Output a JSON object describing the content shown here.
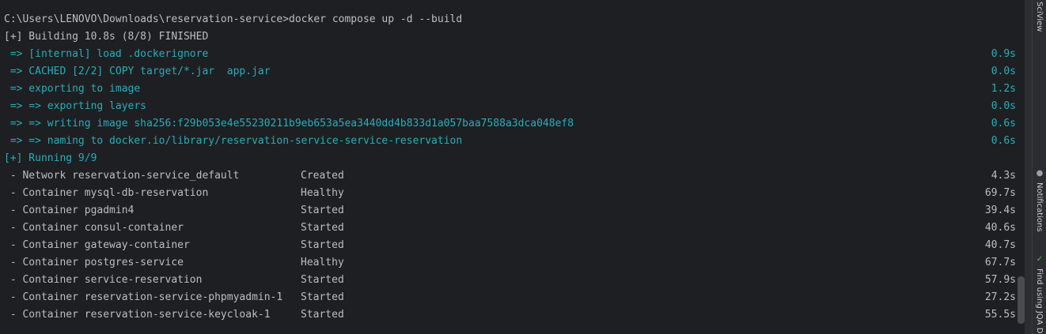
{
  "terminal": {
    "command_line": "C:\\Users\\LENOVO\\Downloads\\reservation-service>docker compose up -d --build",
    "build_header": "[+] Building 10.8s (8/8) FINISHED",
    "build_steps": [
      {
        "text": " => [internal] load .dockerignore",
        "time": "0.9s"
      },
      {
        "text": " => CACHED [2/2] COPY target/*.jar  app.jar",
        "time": "0.0s"
      },
      {
        "text": " => exporting to image",
        "time": "1.2s"
      },
      {
        "text": " => => exporting layers",
        "time": "0.0s"
      },
      {
        "text": " => => writing image sha256:f29b053e4e55230211b9eb653a5ea3440dd4b833d1a057baa7588a3dca048ef8",
        "time": "0.6s"
      },
      {
        "text": " => => naming to docker.io/library/reservation-service-service-reservation",
        "time": "0.6s"
      }
    ],
    "running_header": "[+] Running 9/9",
    "running_items": [
      {
        "text": " - Network reservation-service_default",
        "status": "Created",
        "time": "4.3s"
      },
      {
        "text": " - Container mysql-db-reservation",
        "status": "Healthy",
        "time": "69.7s"
      },
      {
        "text": " - Container pgadmin4",
        "status": "Started",
        "time": "39.4s"
      },
      {
        "text": " - Container consul-container",
        "status": "Started",
        "time": "40.6s"
      },
      {
        "text": " - Container gateway-container",
        "status": "Started",
        "time": "40.7s"
      },
      {
        "text": " - Container postgres-service",
        "status": "Healthy",
        "time": "67.7s"
      },
      {
        "text": " - Container service-reservation",
        "status": "Started",
        "time": "57.9s"
      },
      {
        "text": " - Container reservation-service-phpmyadmin-1",
        "status": "Started",
        "time": "27.2s"
      },
      {
        "text": " - Container reservation-service-keycloak-1",
        "status": "Started",
        "time": "55.5s"
      }
    ]
  },
  "side_panel": {
    "sciview_label": "SciView",
    "notifications_label": "Notifications",
    "find_label": "Find using JQA D"
  },
  "colors": {
    "terminal_bg": "#1e1f22",
    "text": "#bcbec4",
    "accent_cyan": "#2aacb8"
  }
}
